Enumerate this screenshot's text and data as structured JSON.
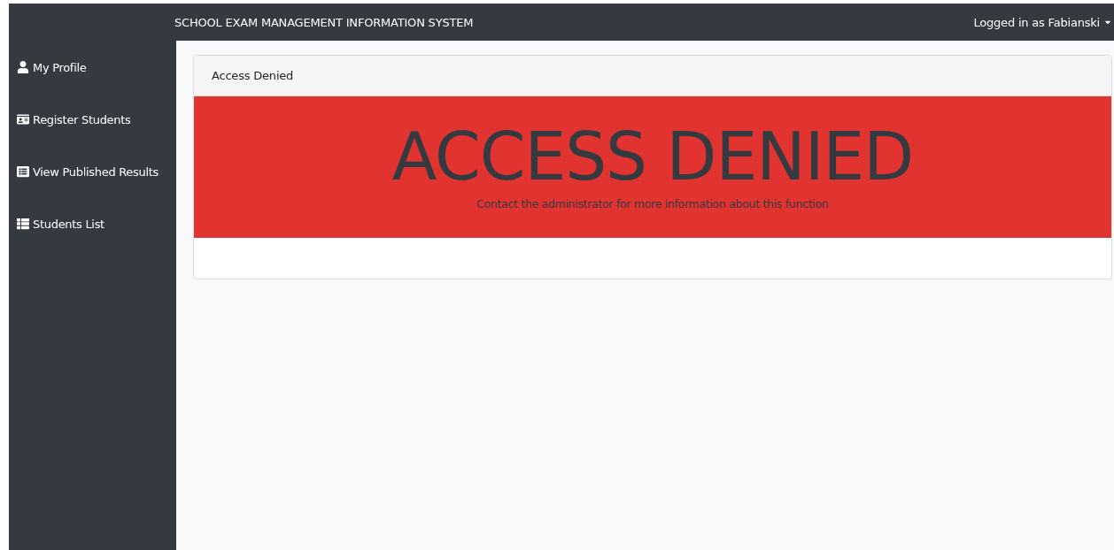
{
  "topbar": {
    "title": "SCHOOL EXAM MANAGEMENT INFORMATION SYSTEM",
    "user_menu": "Logged in as Fabianski"
  },
  "sidebar": {
    "items": [
      {
        "kind": "user",
        "label": "My Profile"
      },
      {
        "kind": "card",
        "label": "Register Students"
      },
      {
        "kind": "table",
        "label": "View Published Results"
      },
      {
        "kind": "list",
        "label": "Students List"
      }
    ]
  },
  "card": {
    "header": "Access Denied",
    "alert": {
      "heading": "ACCESS DENIED",
      "message": "Contact the administrator for more information about this function"
    }
  }
}
